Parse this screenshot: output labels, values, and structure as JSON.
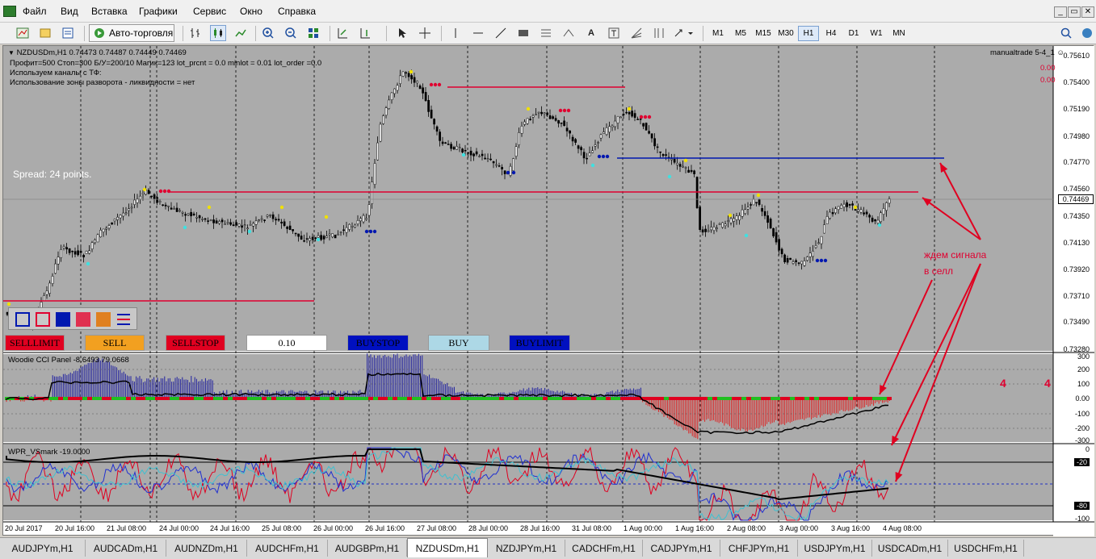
{
  "menu": {
    "items": [
      "Файл",
      "Вид",
      "Вставка",
      "Графики",
      "Сервис",
      "Окно",
      "Справка"
    ]
  },
  "window_controls": {
    "minimize": "_",
    "restore": "▭",
    "close": "✕"
  },
  "toolbar": {
    "autotrade_label": "Авто-торговля",
    "text_tool": "A",
    "timeframes": [
      "M1",
      "M5",
      "M15",
      "M30",
      "H1",
      "H4",
      "D1",
      "W1",
      "MN"
    ],
    "active_timeframe": "H1"
  },
  "chart": {
    "title": "NZDUSDm,H1  0.74473 0.74487 0.74449 0.74469",
    "ea_line1": "Профит=500  Стоп=300  Б/У=200/10  Магик=123 lot_prcnt = 0.0 minlot = 0.01 lot_order =0.0",
    "ea_line2": "Используем каналы с ТФ:",
    "ea_line3": "Использование зоны разворота - ликвидности = нет",
    "ea_name": "manualtrade 5-4_1",
    "ea_value1": "0.00",
    "ea_value2": "0.00",
    "spread": "Spread: 24 points.",
    "annotation_line1": "ждем сигнала",
    "annotation_line2": "в селл",
    "digit_a": "4",
    "digit_b": "4",
    "price_labels": [
      "0.75610",
      "0.75400",
      "0.75190",
      "0.74980",
      "0.74770",
      "0.74560",
      "0.74469",
      "0.74350",
      "0.74130",
      "0.73920",
      "0.73710",
      "0.73490",
      "0.73280"
    ],
    "current_price": "0.74469",
    "cci_label": "Woodie CCI Panel -8.6493 79.0668",
    "cci_levels": [
      "300",
      "200",
      "100",
      "0.00",
      "-100",
      "-200",
      "-300"
    ],
    "wpr_label": "WPR_VSmark -19.0000",
    "wpr_levels": [
      "0",
      "-20",
      "-80",
      "-100"
    ],
    "dates": [
      "20 Jul 2017",
      "20 Jul 16:00",
      "21 Jul 08:00",
      "24 Jul 00:00",
      "24 Jul 16:00",
      "25 Jul 08:00",
      "26 Jul 00:00",
      "26 Jul 16:00",
      "27 Jul 08:00",
      "28 Jul 00:00",
      "28 Jul 16:00",
      "31 Jul 08:00",
      "1 Aug 00:00",
      "1 Aug 16:00",
      "2 Aug 08:00",
      "3 Aug 00:00",
      "3 Aug 16:00",
      "4 Aug 08:00"
    ]
  },
  "trade_panel": {
    "sell_limit": "SELLLIMIT",
    "sell": "SELL",
    "sell_stop": "SELLSTOP",
    "lot": "0.10",
    "buy_stop": "BUYSTOP",
    "buy": "BUY",
    "buy_limit": "BUYLIMIT"
  },
  "tabs": [
    "AUDJPYm,H1",
    "AUDCADm,H1",
    "AUDNZDm,H1",
    "AUDCHFm,H1",
    "AUDGBPm,H1",
    "NZDUSDm,H1",
    "NZDJPYm,H1",
    "CADCHFm,H1",
    "CADJPYm,H1",
    "CHFJPYm,H1",
    "USDJPYm,H1",
    "USDCADm,H1",
    "USDCHFm,H1"
  ],
  "active_tab": "NZDUSDm,H1",
  "colors": {
    "chart_bg": "#ababab",
    "bull": "#ffffff",
    "bear": "#000000",
    "red_line": "#e00030",
    "blue_line": "#0018b0"
  }
}
